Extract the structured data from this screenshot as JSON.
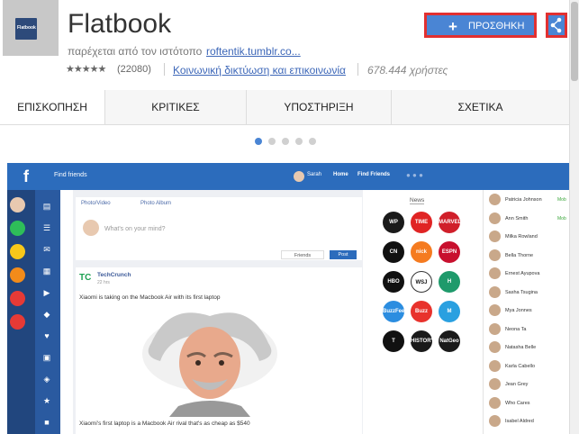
{
  "header": {
    "app_title": "Flatbook",
    "icon_text": "Flatbook",
    "offered_by_label": "παρέχεται από τον ιστότοπο",
    "offered_by_link": "roftentik.tumblr.co...",
    "stars": "★★★★★",
    "rating_count": "(22080)",
    "category": "Κοινωνική δικτύωση και επικοινωνία",
    "users": "678.444 χρήστες",
    "add_button": "ΠΡΟΣΘΗΚΗ",
    "add_plus": "+"
  },
  "tabs": [
    {
      "label": "ΕΠΙΣΚΟΠΗΣΗ"
    },
    {
      "label": "ΚΡΙΤΙΚΕΣ"
    },
    {
      "label": "ΥΠΟΣΤΗΡΙΞΗ"
    },
    {
      "label": "ΣΧΕΤΙΚΑ"
    }
  ],
  "carousel": {
    "active_index": 0,
    "count": 5
  },
  "mockup": {
    "logo": "f",
    "find_friends": "Find friends",
    "user": "Sarah",
    "home": "Home",
    "find_friends_btn": "Find Friends",
    "composer": {
      "photo_video": "Photo/Video",
      "photo_album": "Photo Album",
      "placeholder": "What's on your mind?",
      "audience": "Friends",
      "post": "Post"
    },
    "post": {
      "author": "TechCrunch",
      "time": "22 hrs",
      "text": "Xiaomi is taking on the Macbook Air with its first laptop",
      "caption": "Xiaomi's first laptop is a Macbook Air rival that's as cheap as $540"
    },
    "news_title": "News",
    "news": [
      {
        "label": "WP",
        "color": "#1a1a1a"
      },
      {
        "label": "TIME",
        "color": "#e02424"
      },
      {
        "label": "MARVEL",
        "color": "#d01f2a"
      },
      {
        "label": "CN",
        "color": "#111111"
      },
      {
        "label": "nick",
        "color": "#f57b20"
      },
      {
        "label": "ESPN",
        "color": "#c8102e"
      },
      {
        "label": "HBO",
        "color": "#111111"
      },
      {
        "label": "WSJ",
        "color": "#ffffff"
      },
      {
        "label": "H",
        "color": "#1f9a6b"
      },
      {
        "label": "BuzzFeed",
        "color": "#2b8de0"
      },
      {
        "label": "Buzz Feed",
        "color": "#e8322c"
      },
      {
        "label": "M",
        "color": "#2aa0e0"
      },
      {
        "label": "T",
        "color": "#111111"
      },
      {
        "label": "HISTORY",
        "color": "#1a1a1a"
      },
      {
        "label": "NatGeo",
        "color": "#1a1a1a"
      }
    ],
    "friends": [
      {
        "name": "Patricia Johnson",
        "status": "Mob"
      },
      {
        "name": "Ann Smith",
        "status": "Mob"
      },
      {
        "name": "Milka Rowland",
        "status": ""
      },
      {
        "name": "Bella Thorne",
        "status": ""
      },
      {
        "name": "Ernest Ayupova",
        "status": ""
      },
      {
        "name": "Sasha Tsugina",
        "status": ""
      },
      {
        "name": "Mya Jonnes",
        "status": ""
      },
      {
        "name": "Neona Ta",
        "status": ""
      },
      {
        "name": "Natasha Belle",
        "status": ""
      },
      {
        "name": "Karla Cabello",
        "status": ""
      },
      {
        "name": "Jean Grey",
        "status": ""
      },
      {
        "name": "Who Cares",
        "status": ""
      },
      {
        "name": "Isabel Aldred",
        "status": ""
      }
    ]
  },
  "colors": {
    "add_button_bg": "#4a85d4",
    "highlight_border": "#e23030",
    "fb_blue": "#2c6cbc",
    "link": "#3d67b8"
  }
}
